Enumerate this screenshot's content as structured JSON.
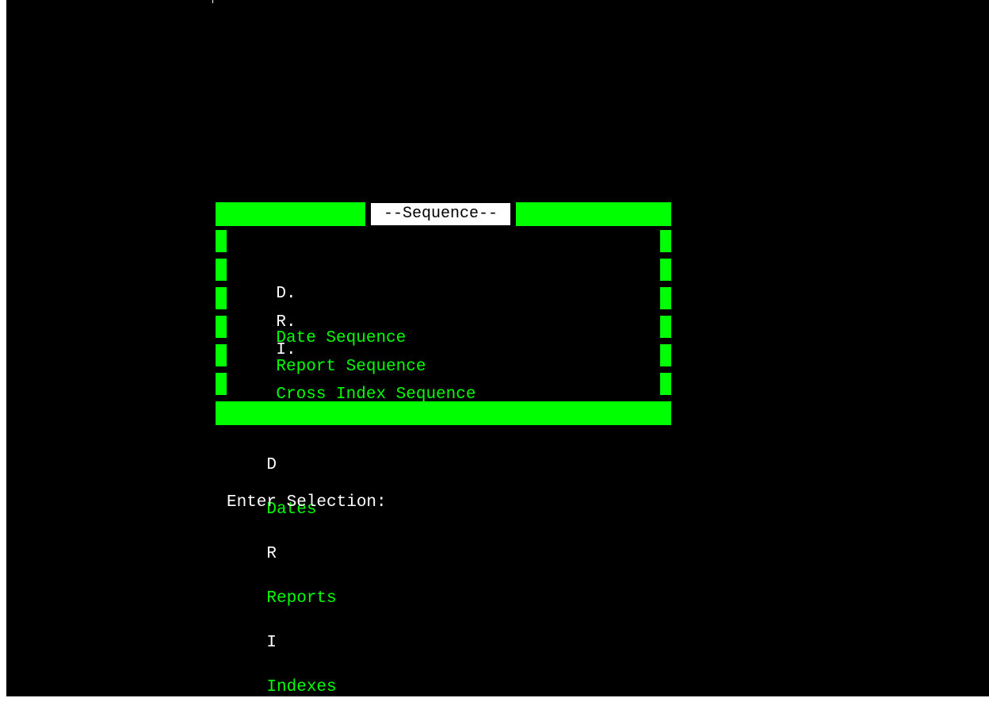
{
  "window": {
    "title": "--Sequence--"
  },
  "menu": {
    "items": [
      {
        "key": "D.",
        "label": "Date Sequence"
      },
      {
        "key": "R.",
        "label": "Report Sequence"
      },
      {
        "key": "I.",
        "label": "Cross Index Sequence"
      }
    ]
  },
  "hints": [
    {
      "key": "D",
      "label": "Dates"
    },
    {
      "key": "R",
      "label": "Reports"
    },
    {
      "key": "I",
      "label": "Indexes"
    }
  ],
  "prompt": {
    "label": "Enter Selection:",
    "value": ""
  },
  "colors": {
    "background": "#000000",
    "accent": "#00ff00",
    "text": "#ffffff"
  }
}
